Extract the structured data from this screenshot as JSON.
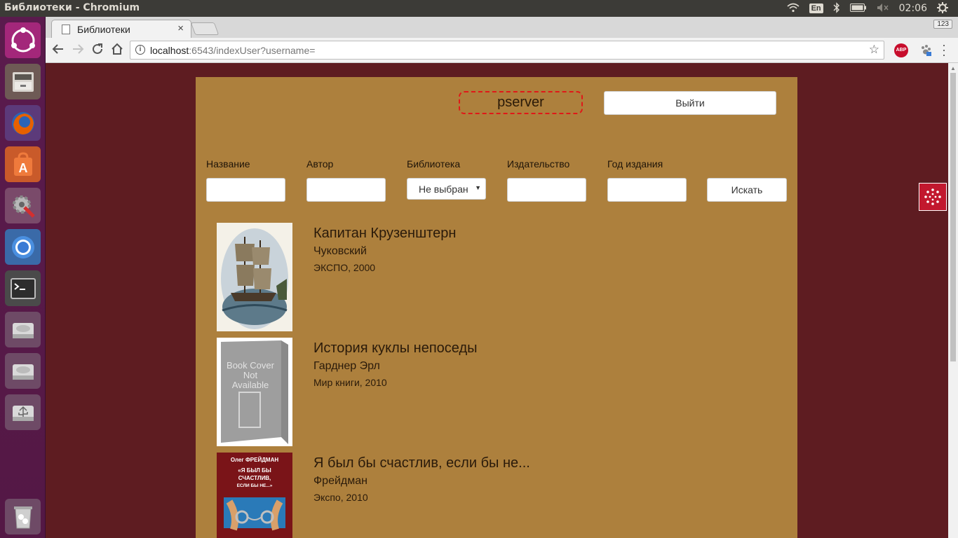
{
  "system": {
    "window_title": "Библиотеки - Chromium",
    "lang": "En",
    "time": "02:06"
  },
  "browser": {
    "tab_title": "Библиотеки",
    "tab_close": "×",
    "tab_badge": "123",
    "url_host": "localhost",
    "url_rest": ":6543/indexUser?username=",
    "abp_label": "ABP"
  },
  "header": {
    "username": "pserver",
    "logout_label": "Выйти"
  },
  "filters": {
    "title_label": "Название",
    "author_label": "Автор",
    "library_label": "Библиотека",
    "library_value": "Не выбрано",
    "publisher_label": "Издательство",
    "year_label": "Год издания",
    "search_label": "Искать"
  },
  "books": [
    {
      "title": "Капитан Крузенштерн",
      "author": "Чуковский",
      "publication": "ЭКСПО, 2000",
      "cover_icon": "ship-cover-image"
    },
    {
      "title": "История куклы непоседы",
      "author": "Гарднер Эрл",
      "publication": "Мир книги, 2010",
      "cover_icon": "placeholder-cover-image",
      "cover_text": "Book Cover Not Available"
    },
    {
      "title": "Я был бы счастлив, если бы не...",
      "author": "Фрейдман",
      "publication": "Экспо, 2010",
      "cover_icon": "handcuffs-cover-image",
      "cover_author": "Олег ФРЕЙДМАН",
      "cover_title": "«Я БЫЛ БЫ СЧАСТЛИВ, ЕСЛИ БЫ НЕ...»"
    }
  ],
  "colors": {
    "page_background": "#5e1c21",
    "panel_background": "#ad803d",
    "username_border": "#e01818"
  }
}
